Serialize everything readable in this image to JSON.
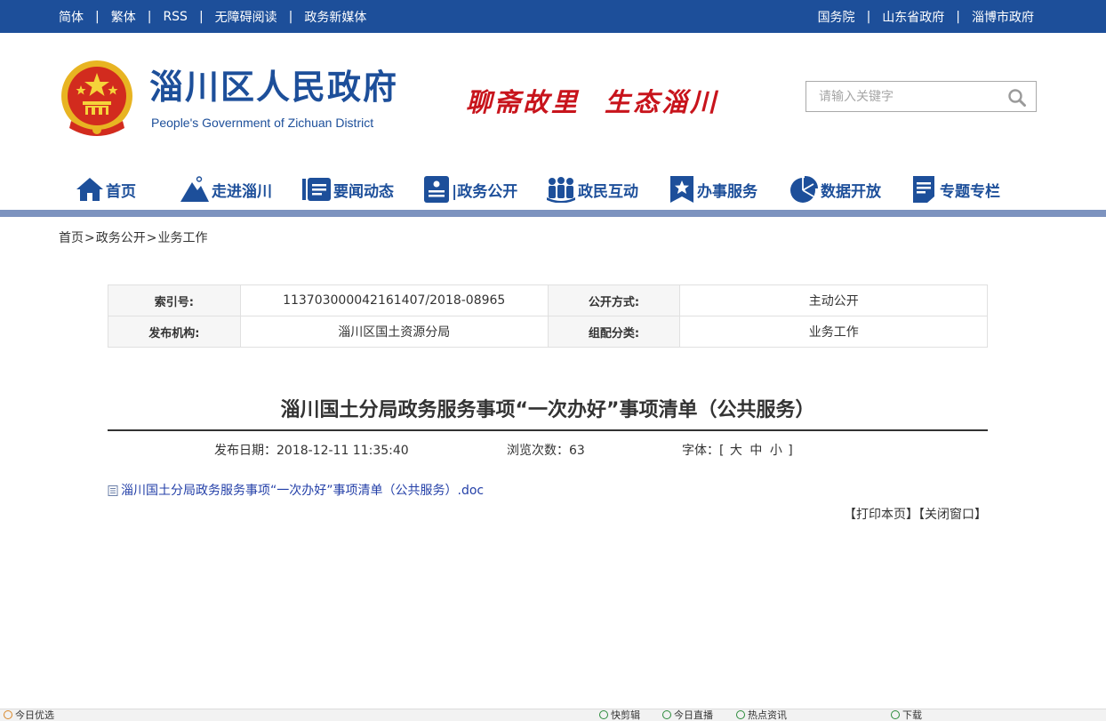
{
  "topbar": {
    "left_links": [
      "简体",
      "繁体",
      "RSS",
      "无障碍阅读",
      "政务新媒体"
    ],
    "right_links": [
      "国务院",
      "山东省政府",
      "淄博市政府"
    ]
  },
  "header": {
    "title": "淄川区人民政府",
    "subtitle": "People's Government of Zichuan District",
    "slogan_left": "聊斋故里",
    "slogan_right": "生态淄川"
  },
  "search": {
    "placeholder": "请输入关键字"
  },
  "nav": {
    "items": [
      {
        "label": "首页",
        "icon": "home-icon"
      },
      {
        "label": "走进淄川",
        "icon": "mountain-icon"
      },
      {
        "label": "要闻动态",
        "icon": "news-icon"
      },
      {
        "label": "|政务公开",
        "icon": "document-icon"
      },
      {
        "label": "政民互动",
        "icon": "people-icon"
      },
      {
        "label": "办事服务",
        "icon": "star-bookmark-icon"
      },
      {
        "label": "数据开放",
        "icon": "pie-chart-icon"
      },
      {
        "label": "专题专栏",
        "icon": "notes-icon"
      }
    ]
  },
  "breadcrumb": {
    "items": [
      "首页",
      "政务公开",
      "业务工作"
    ],
    "separator": ">"
  },
  "meta": {
    "index_label": "索引号:",
    "index_value": "113703000042161407/2018-08965",
    "open_label": "公开方式:",
    "open_value": "主动公开",
    "publisher_label": "发布机构:",
    "publisher_value": "淄川区国土资源分局",
    "category_label": "组配分类:",
    "category_value": "业务工作"
  },
  "article": {
    "title": "淄川国土分局政务服务事项“一次办好”事项清单（公共服务）",
    "date_label": "发布日期：",
    "date_value": "2018-12-11 11:35:40",
    "views_label": "浏览次数：",
    "views_value": "63",
    "font_label": "字体：",
    "font_open": "[",
    "font_large": "大",
    "font_medium": "中",
    "font_small": "小",
    "font_close": "]",
    "attachment": "淄川国土分局政务服务事项“一次办好”事项清单（公共服务）.doc",
    "print_label": "【打印本页】",
    "close_label": "【关闭窗口】"
  },
  "statusbar": {
    "left": "今日优选",
    "items": [
      "快剪辑",
      "今日直播",
      "热点资讯",
      "下载"
    ]
  },
  "colors": {
    "brand_blue": "#1d4f9a",
    "nav_rule": "#7d93bf",
    "slogan_red": "#c8141c",
    "link_blue": "#2440a8"
  }
}
